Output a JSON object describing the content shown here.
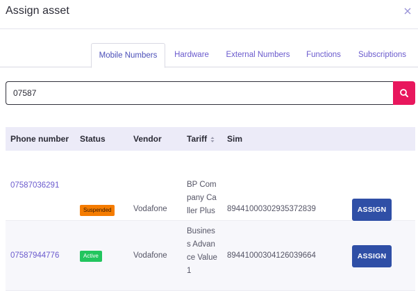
{
  "dialog": {
    "title": "Assign asset",
    "close_icon": "close-icon"
  },
  "tabs": [
    {
      "label": "Mobile Numbers",
      "active": true
    },
    {
      "label": "Hardware",
      "active": false
    },
    {
      "label": "External Numbers",
      "active": false
    },
    {
      "label": "Functions",
      "active": false
    },
    {
      "label": "Subscriptions",
      "active": false
    }
  ],
  "search": {
    "value": "07587",
    "placeholder": "",
    "button_icon": "search-icon",
    "button_color": "#e8175d"
  },
  "table": {
    "columns": [
      "Phone number",
      "Status",
      "Vendor",
      "Tariff",
      "Sim"
    ],
    "sort_icon": "sort-icon",
    "rows": [
      {
        "phone": "07587036291",
        "status": "Suspended",
        "vendor": "Vodafone",
        "tariff": "BP Company Caller Plus",
        "sim": "89441000302935372839",
        "action": "ASSIGN"
      },
      {
        "phone": "07587944776",
        "status": "Active",
        "vendor": "Vodafone",
        "tariff": "Business Advance Value 1",
        "sim": "89441000304126039664",
        "action": "ASSIGN"
      }
    ]
  },
  "colors": {
    "accent": "#6a5acd",
    "assign_button": "#2f4fa6",
    "suspended": "#f57c00",
    "active": "#22c55e"
  }
}
